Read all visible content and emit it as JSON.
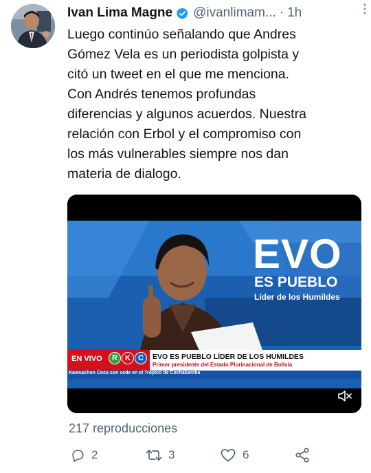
{
  "tweet": {
    "author_name": "Ivan Lima Magne",
    "handle": "@ivanlimam...",
    "separator": "·",
    "time": "1h",
    "text_lines": [
      "Luego continúo señalando que Andres",
      "Gómez Vela es un periodista golpista y",
      "citó un tweet en el que me menciona.",
      "Con Andrés tenemos profundas",
      "diferencias y algunos acuerdos. Nuestra",
      "relación con Erbol y el compromiso con",
      "los más vulnerables siempre nos dan",
      "materia de dialogo."
    ],
    "views": "217 reproducciones",
    "replies": "2",
    "retweets": "3",
    "likes": "6"
  },
  "video": {
    "graphic_title": "EVO",
    "graphic_subtitle": "ES PUEBLO",
    "graphic_caption": "Líder de los Humildes",
    "live_badge": "EN VIVO",
    "channel_letters": [
      "R",
      "K",
      "C"
    ],
    "lower_third_title": "EVO ES PUEBLO LÍDER DE LOS HUMILDES",
    "lower_third_subtitle": "Primer presidente del Estado Plurinacional de Bolivia",
    "ticker": "Kawsachun Coca con sede en el Tropico de Cochabamba",
    "muted": true
  },
  "icons": {
    "verified": "verified-badge-icon",
    "more": "more-vertical-icon",
    "reply": "reply-icon",
    "retweet": "retweet-icon",
    "like": "heart-icon",
    "share": "share-icon",
    "mute": "volume-muted-icon"
  },
  "colors": {
    "text": "#0f1419",
    "secondary": "#536471",
    "verified": "#1d9bf0",
    "live_red": "#d4101c"
  }
}
